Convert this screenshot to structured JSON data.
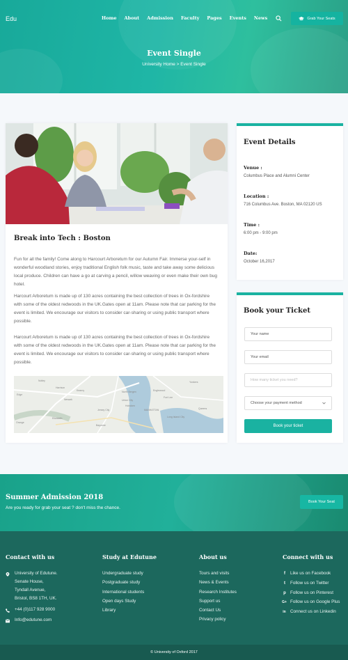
{
  "header": {
    "logo": "Edu",
    "nav": [
      "Home",
      "About",
      "Admission",
      "Faculty",
      "Pages",
      "Events",
      "News"
    ],
    "cta": "Grab Your Seats",
    "title": "Event Single",
    "breadcrumb": "University Home  > Event Single"
  },
  "post": {
    "title": "Break into Tech : Boston",
    "paragraphs": [
      "Fun for all the family! Come along to Harcourt Arboretum for our Autumn Fair. Immerse your-self in wonderful woodland stories, enjoy traditional English folk music, taste and take away some delicious local produce. Children can have a go at carving a pencil, willow weaving or even make their own bug hotel.",
      "Harcourt Arboretum is made up of 130 acres containing the best collection of trees in Ox-fordshire with some of the oldest redwoods in the UK.Gates open at 11am. Please note that car parking for the event is limited. We encourage our visitors to consider car-sharing or using public transport where possible.",
      "Harcourt Arboretum is made up of 130 acres containing the best collection of trees in Ox-fordshire with some of the oldest redwoods in the UK.Gates open at 11am. Please note that car parking for the event is limited. We encourage our visitors to consider car-sharing or using public transport where possible."
    ],
    "map_labels": [
      "Nutley",
      "Yonkers",
      "Englewood",
      "Fort Lee",
      "North Bergen",
      "Union City",
      "MANHATTAN",
      "Newark",
      "Jersey City",
      "Long Island City",
      "Elizabeth",
      "Bayonne",
      "Hoboken",
      "Queens",
      "Orange",
      "Kearny",
      "Harrison",
      "Edge"
    ]
  },
  "event_details": {
    "title": "Event Details",
    "venue_label": "Venue :",
    "venue": "Columbus Place and Alumni Center",
    "location_label": "Location :",
    "location": "716 Columbus Ave. Boston, MA 02120 US",
    "time_label": "Time :",
    "time": "6:00 pm - 9:00 pm",
    "date_label": "Date:",
    "date": "October 16,2017"
  },
  "ticket": {
    "title": "Book your Ticket",
    "name_placeholder": "Your name",
    "email_placeholder": "Your email",
    "count_placeholder": "How many ticket you need?",
    "payment_select": "Choose your payment method",
    "submit": "Book your ticket"
  },
  "banner": {
    "title": "Summer Admission 2018",
    "subtitle": "Are you ready for grab your seat ? don't miss the chance.",
    "button": "Book Your Seat"
  },
  "footer": {
    "contact_title": "Contact with us",
    "address": [
      "University of Edutune.",
      "Senate House,",
      "Tyndall Avenue,",
      "Bristol, BS8 1TH, UK."
    ],
    "phone": "+44 (0)117 928 9000",
    "email": "Info@edutune.com",
    "study_title": "Study at Edutune",
    "study_links": [
      "Undergraduate study",
      "Postgraduate study",
      "International students",
      "Open days Study",
      "Library"
    ],
    "about_title": "About us",
    "about_links": [
      "Tours and visits",
      "News & Events",
      "Research Institutes",
      "Support us",
      "Contact Us",
      "Privacy policy"
    ],
    "connect_title": "Connect with us",
    "social": [
      {
        "icon": "facebook-icon",
        "glyph": "f",
        "label": "Like us on Facebook"
      },
      {
        "icon": "twitter-icon",
        "glyph": "t",
        "label": "Follow us on Twitter"
      },
      {
        "icon": "pinterest-icon",
        "glyph": "p",
        "label": "Follow us on Pinterest"
      },
      {
        "icon": "google-plus-icon",
        "glyph": "G+",
        "label": "Follow us on Google Plus"
      },
      {
        "icon": "linkedin-icon",
        "glyph": "in",
        "label": "Connect us on Linkedin"
      }
    ],
    "copyright": "© University of Oxford 2017"
  },
  "colors": {
    "accent": "#1ab2a1",
    "footer": "#1c685d",
    "footer_bottom": "#185a50"
  }
}
